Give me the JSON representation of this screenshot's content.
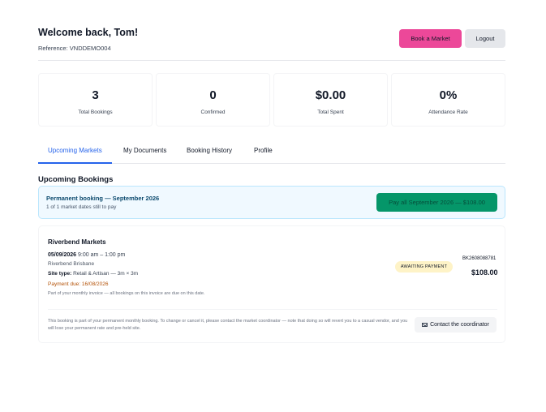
{
  "header": {
    "welcome": "Welcome back, Tom!",
    "reference": "Reference: VNDDEMO004",
    "book_button": "Book a Market",
    "logout_button": "Logout"
  },
  "stats": [
    {
      "value": "3",
      "label": "Total Bookings"
    },
    {
      "value": "0",
      "label": "Confirmed"
    },
    {
      "value": "$0.00",
      "label": "Total Spent"
    },
    {
      "value": "0%",
      "label": "Attendance Rate"
    }
  ],
  "tabs": [
    {
      "label": "Upcoming Markets",
      "active": true
    },
    {
      "label": "My Documents",
      "active": false
    },
    {
      "label": "Booking History",
      "active": false
    },
    {
      "label": "Profile",
      "active": false
    }
  ],
  "section_title": "Upcoming Bookings",
  "permanent_banner": {
    "title": "Permanent booking — September 2026",
    "subtitle": "1 of 1 market dates still to pay",
    "pay_button": "Pay all September 2026 — $108.00"
  },
  "booking": {
    "market_name": "Riverbend Markets",
    "date": "05/09/2026",
    "time": "9:00 am – 1:00 pm",
    "location": "Riverbend Brisbane",
    "site_type_label": "Site type:",
    "site_type": "Retail & Artisan — 3m × 3m",
    "payment_due": "Payment due: 16/08/2026",
    "invoice_note": "Part of your monthly invoice — all bookings on this invoice are due on this date.",
    "status_badge": "AWAITING PAYMENT",
    "booking_ref": "BK2608088781",
    "amount": "$108.00",
    "permanent_note": "This booking is part of your permanent monthly booking. To change or cancel it, please contact the market coordinator — note that doing so will revert you to a casual vendor, and you will lose your permanent rate and pre-held site.",
    "contact_button": "Contact the coordinator"
  },
  "icons": {
    "contact": "mail-icon"
  },
  "colors": {
    "brand_pink": "#ec4899",
    "accent_blue": "#2563eb",
    "pay_green": "#059669",
    "warning_amber": "#b45309"
  }
}
